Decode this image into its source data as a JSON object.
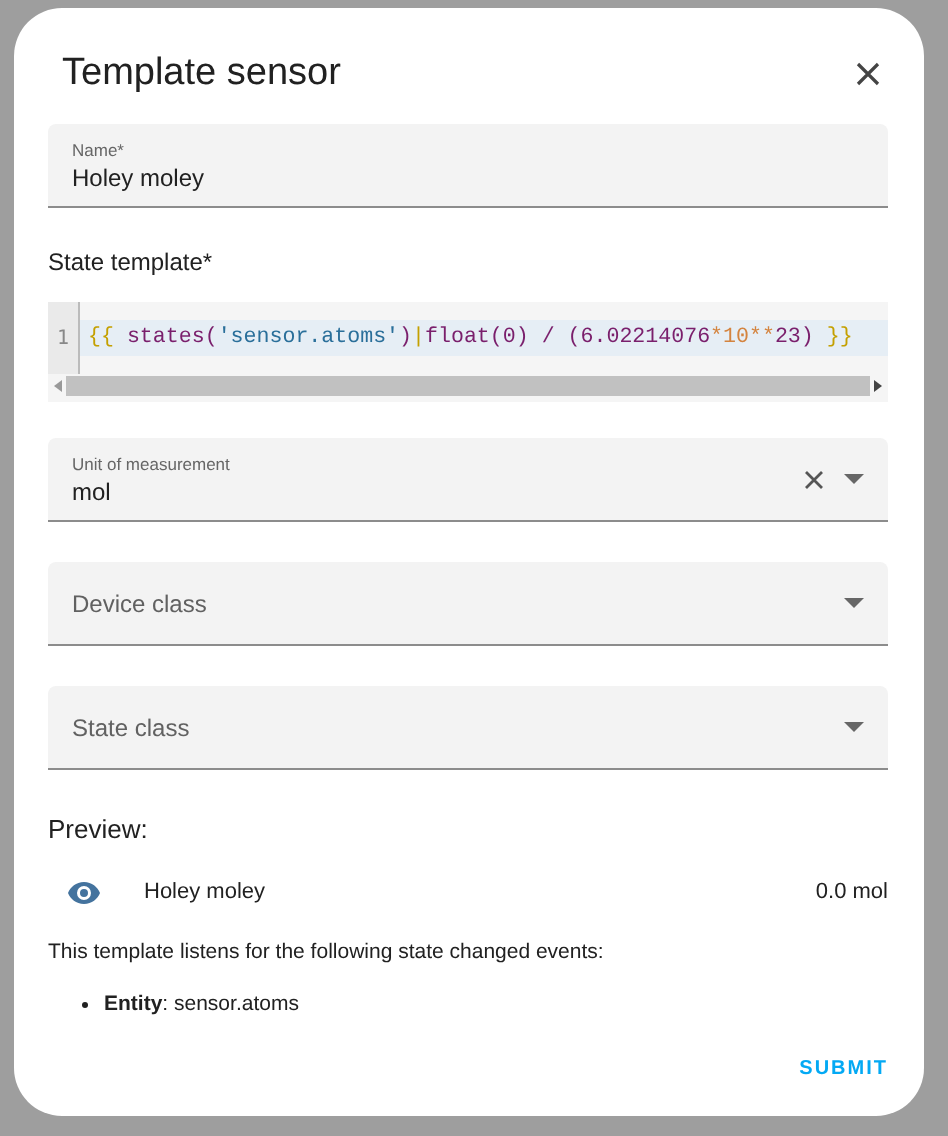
{
  "dialog": {
    "title": "Template sensor"
  },
  "name_field": {
    "label": "Name*",
    "value": "Holey moley"
  },
  "state_template": {
    "label": "State template*",
    "line_number": "1",
    "tokens": [
      {
        "text": "{{ ",
        "kind": "bracket"
      },
      {
        "text": "states(",
        "kind": "func"
      },
      {
        "text": "'sensor.atoms'",
        "kind": "string"
      },
      {
        "text": ")",
        "kind": "func"
      },
      {
        "text": "|",
        "kind": "bracket"
      },
      {
        "text": "float(0) / (6.02214076",
        "kind": "func"
      },
      {
        "text": "*10**",
        "kind": "number"
      },
      {
        "text": "23) ",
        "kind": "func"
      },
      {
        "text": "}}",
        "kind": "bracket"
      }
    ]
  },
  "selects": [
    {
      "label": "Unit of measurement",
      "value": "mol",
      "clearable": true
    },
    {
      "label": "Device class",
      "clearable": false
    },
    {
      "label": "State class",
      "clearable": false
    }
  ],
  "preview": {
    "heading": "Preview:",
    "entity_name": "Holey moley",
    "state": "0.0 mol",
    "listens_text": "This template listens for the following state changed events:",
    "events": [
      "**Entity**: sensor.atoms"
    ]
  },
  "submit_button": "SUBMIT"
}
